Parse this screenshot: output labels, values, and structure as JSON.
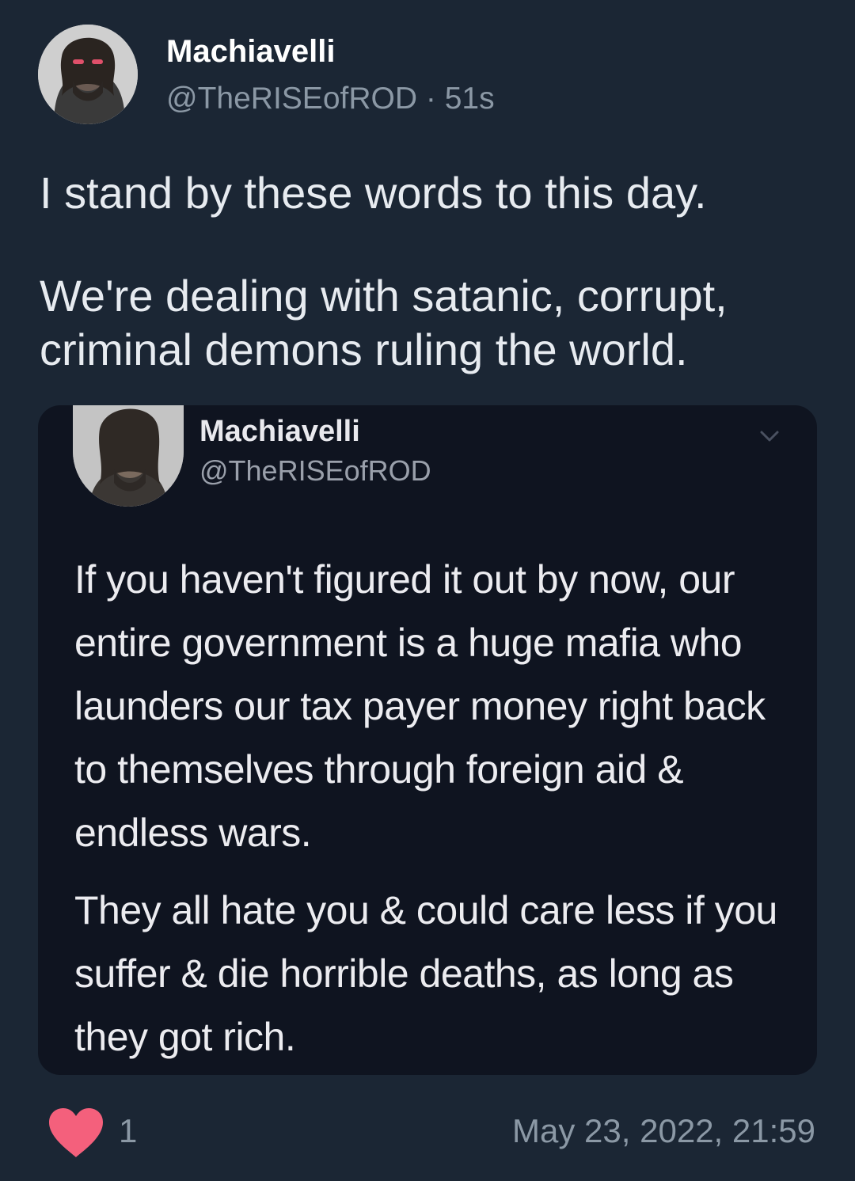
{
  "tweet": {
    "author_name": "Machiavelli",
    "handle": "@TheRISEofROD",
    "separator": "·",
    "age": "51s",
    "text_paragraphs": [
      "I stand by these words to this day.",
      "We're dealing with satanic, corrupt, criminal demons ruling the world."
    ],
    "like_count": "1",
    "timestamp": "May 23, 2022, 21:59"
  },
  "quoted": {
    "author_name": "Machiavelli",
    "handle": "@TheRISEofROD",
    "text_paragraphs": [
      "If you haven't figured it out by now, our entire government is a huge mafia who launders our tax payer money right back to themselves through foreign aid & endless wars.",
      "They all hate you & could care less if you suffer & die horrible deaths, as long as they got rich."
    ]
  },
  "icons": {
    "like": "heart-icon",
    "more": "chevron-down-icon"
  },
  "colors": {
    "background": "#1b2634",
    "quoted_background": "#0f1420",
    "secondary_text": "#8b98a5",
    "heart": "#f4607c"
  }
}
